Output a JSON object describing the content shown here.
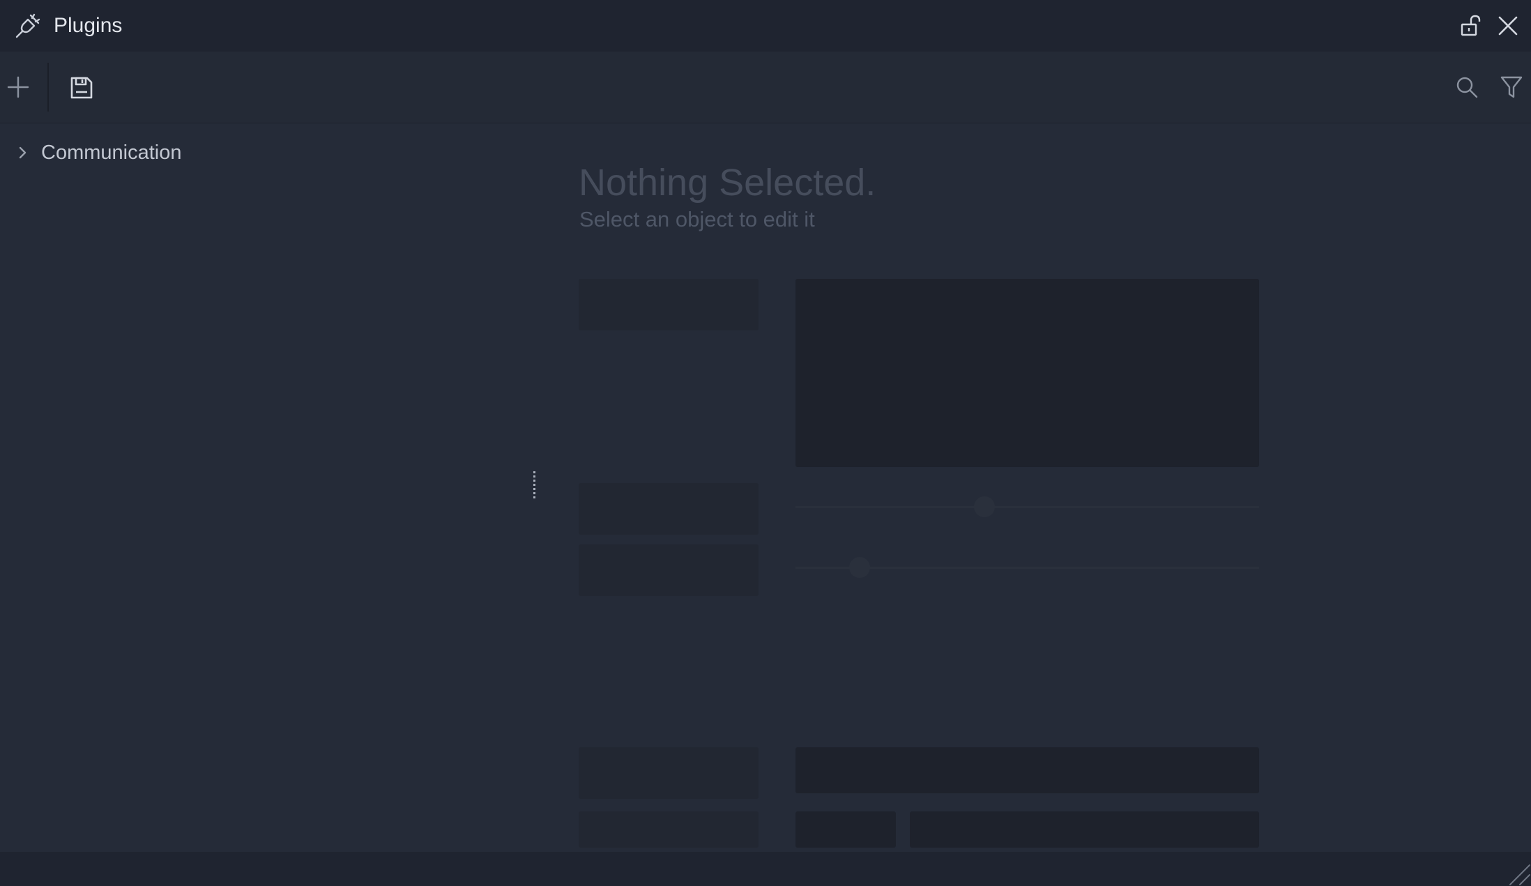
{
  "window": {
    "title": "Plugins"
  },
  "titlebar": {
    "icon": "plug-icon",
    "lock_icon": "unlock-icon",
    "close_icon": "close-icon"
  },
  "toolbar": {
    "add_icon": "plus-icon",
    "save_icon": "save-icon",
    "search_icon": "search-icon",
    "filter_icon": "filter-icon"
  },
  "tree": {
    "items": [
      {
        "label": "Communication",
        "expanded": false
      }
    ]
  },
  "inspector": {
    "empty_title": "Nothing Selected.",
    "empty_subtitle": "Select an object to edit it"
  },
  "colors": {
    "background": "#252b38",
    "titlebar": "#1f2430",
    "text": "#c3c8d2",
    "muted_text": "#464d5c"
  }
}
